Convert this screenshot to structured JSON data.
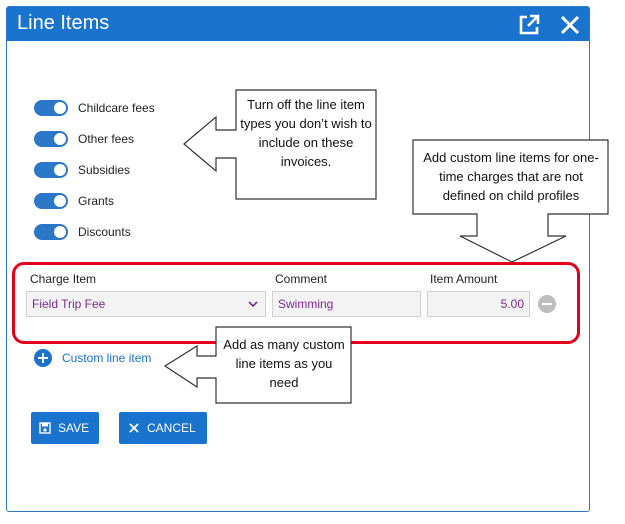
{
  "dialog": {
    "title": "Line Items",
    "popout_icon": "external-link-icon",
    "close_icon": "close-icon"
  },
  "toggles": [
    {
      "label": "Childcare fees",
      "on": true
    },
    {
      "label": "Other fees",
      "on": true
    },
    {
      "label": "Subsidies",
      "on": true
    },
    {
      "label": "Grants",
      "on": true
    },
    {
      "label": "Discounts",
      "on": true
    }
  ],
  "charges": {
    "headers": {
      "charge_item": "Charge Item",
      "comment": "Comment",
      "item_amount": "Item Amount"
    },
    "row": {
      "charge_item": "Field Trip Fee",
      "comment": "Swimming",
      "item_amount": "5.00"
    }
  },
  "add_link": {
    "label": "Custom line item"
  },
  "buttons": {
    "save": "SAVE",
    "cancel": "CANCEL"
  },
  "callouts": {
    "toggles_note": "Turn off the line item types you don’t wish to include on these invoices.",
    "custom_note": "Add custom line items for one-time charges that are not defined on child profiles",
    "add_note": "Add as many custom line items as you need"
  },
  "colors": {
    "accent": "#1a73cc",
    "highlight": "#e3001b",
    "value_text": "#7b2a8e"
  }
}
